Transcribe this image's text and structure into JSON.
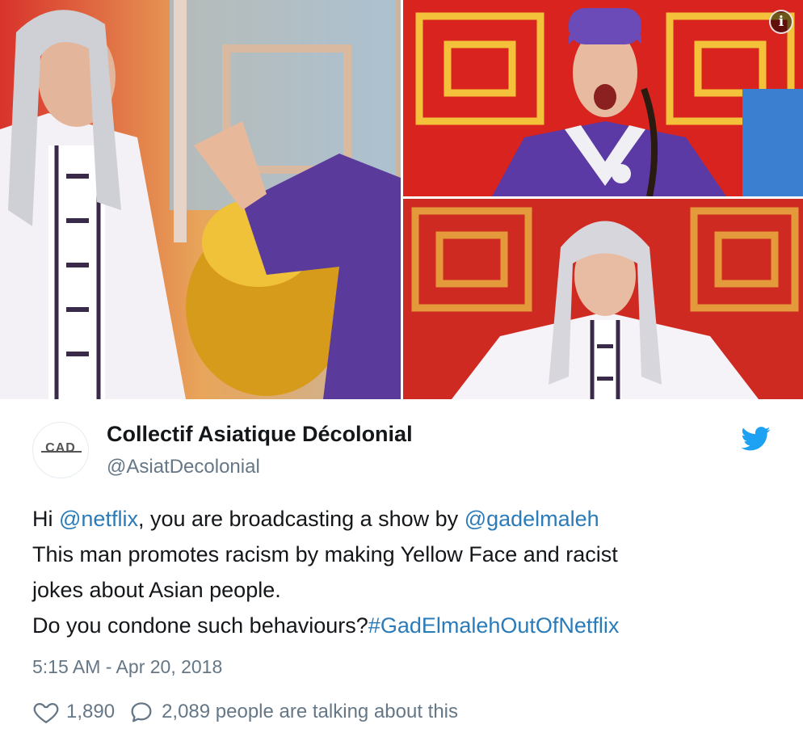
{
  "media": {
    "info_icon": "info-icon",
    "photos": [
      "photo-left",
      "photo-top-right",
      "photo-bottom-right"
    ]
  },
  "tweet": {
    "avatar_text": "CAD",
    "display_name": "Collectif Asiatique Décolonial",
    "handle": "@AsiatDecolonial",
    "body": {
      "line1_prefix": "Hi ",
      "line1_mention1": "@netflix",
      "line1_middle": ", you are broadcasting a show by ",
      "line1_mention2": "@gadelmaleh",
      "line2": "This man promotes racism by making Yellow Face and racist",
      "line3": "jokes about Asian people.",
      "line4_prefix": "Do you condone such behaviours?",
      "line4_hashtag": "#GadElmalehOutOfNetflix"
    },
    "timestamp": "5:15 AM - Apr 20, 2018",
    "likes": "1,890",
    "talking": "2,089 people are talking about this"
  },
  "colors": {
    "link": "#2b7bb9",
    "twitter_blue": "#1da1f2",
    "muted": "#657786"
  }
}
